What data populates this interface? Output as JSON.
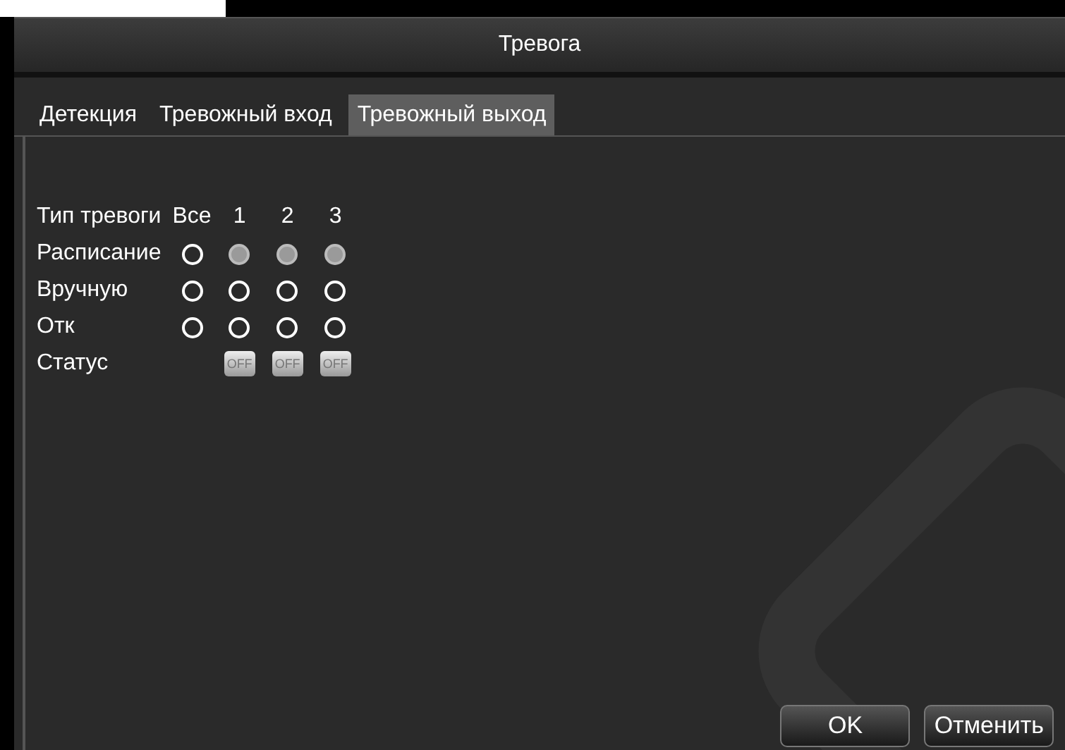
{
  "window": {
    "title": "Тревога"
  },
  "tabs": [
    {
      "label": "Детекция",
      "selected": false
    },
    {
      "label": "Тревожный вход",
      "selected": false
    },
    {
      "label": "Тревожный выход",
      "selected": true
    }
  ],
  "header": {
    "label": "Тип тревоги",
    "columns": [
      "Все",
      "1",
      "2",
      "3"
    ]
  },
  "rows": [
    {
      "kind": "radio",
      "label": "Расписание",
      "all": false,
      "channels": [
        true,
        true,
        true
      ]
    },
    {
      "kind": "radio",
      "label": "Вручную",
      "all": false,
      "channels": [
        false,
        false,
        false
      ]
    },
    {
      "kind": "radio",
      "label": "Отк",
      "all": false,
      "channels": [
        false,
        false,
        false
      ]
    },
    {
      "kind": "status",
      "label": "Статус",
      "channels": [
        {
          "text": "OFF",
          "on": false
        },
        {
          "text": "OFF",
          "on": false
        },
        {
          "text": "OFF",
          "on": false
        }
      ]
    }
  ],
  "buttons": [
    "OK",
    "Отменить"
  ]
}
